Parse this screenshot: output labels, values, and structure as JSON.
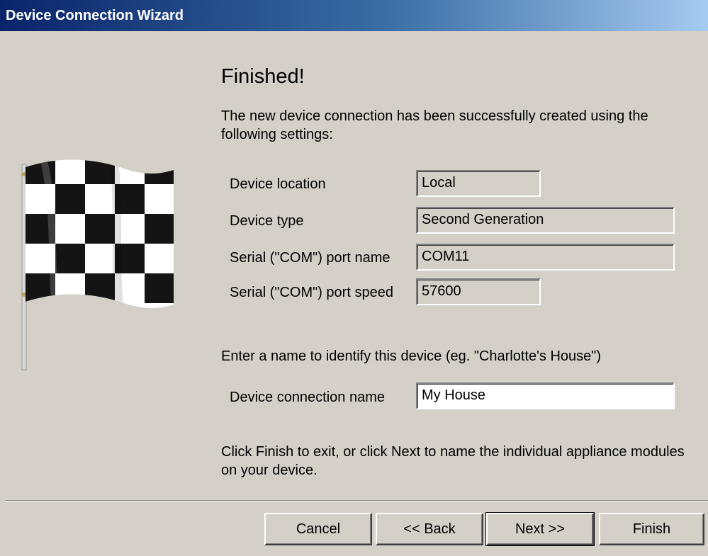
{
  "window": {
    "title": "Device Connection Wizard"
  },
  "heading": "Finished!",
  "intro": "The new device connection has been successfully created using the following settings:",
  "settings": [
    {
      "label": "Device location",
      "value": "Local"
    },
    {
      "label": "Device type",
      "value": "Second Generation"
    },
    {
      "label": "Serial (\"COM\") port name",
      "value": "COM11"
    },
    {
      "label": "Serial (\"COM\") port speed",
      "value": "57600"
    }
  ],
  "name_prompt": "Enter a name to identify this device (eg. \"Charlotte's House\")",
  "connection_name": {
    "label": "Device connection name",
    "value": "My House"
  },
  "footer_text": "Click Finish to exit, or click Next to name the individual appliance modules on your device.",
  "buttons": {
    "cancel": "Cancel",
    "back": "<< Back",
    "next": "Next >>",
    "finish": "Finish"
  },
  "icons": {
    "flag": "checkered-flag-icon"
  }
}
